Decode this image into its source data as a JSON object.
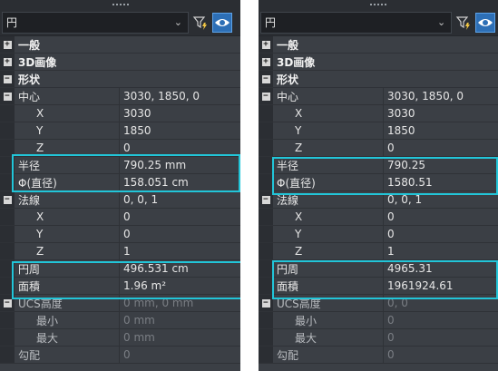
{
  "panels": [
    {
      "selector_value": "円",
      "rows": [
        {
          "kind": "cat",
          "expander": "+",
          "name": "一般",
          "value": ""
        },
        {
          "kind": "cat",
          "expander": "+",
          "name": "3D画像",
          "value": ""
        },
        {
          "kind": "cat",
          "expander": "−",
          "name": "形状",
          "value": ""
        },
        {
          "kind": "prop",
          "expander": "−",
          "indent": 1,
          "name": "中心",
          "value": "3030, 1850, 0"
        },
        {
          "kind": "prop",
          "indent": 2,
          "name": "X",
          "value": "3030"
        },
        {
          "kind": "prop",
          "indent": 2,
          "name": "Y",
          "value": "1850"
        },
        {
          "kind": "prop",
          "indent": 2,
          "name": "Z",
          "value": "0"
        },
        {
          "kind": "prop",
          "indent": 1,
          "name": "半径",
          "value": "790.25 mm"
        },
        {
          "kind": "prop",
          "indent": 1,
          "name": "Φ(直径)",
          "value": "158.051 cm"
        },
        {
          "kind": "prop",
          "expander": "−",
          "indent": 1,
          "name": "法線",
          "value": "0, 0, 1"
        },
        {
          "kind": "prop",
          "indent": 2,
          "name": "X",
          "value": "0"
        },
        {
          "kind": "prop",
          "indent": 2,
          "name": "Y",
          "value": "0"
        },
        {
          "kind": "prop",
          "indent": 2,
          "name": "Z",
          "value": "1"
        },
        {
          "kind": "prop",
          "indent": 1,
          "name": "円周",
          "value": "496.531 cm"
        },
        {
          "kind": "prop",
          "indent": 1,
          "name": "面積",
          "value": "1.96 m²"
        },
        {
          "kind": "prop",
          "expander": "−",
          "indent": 1,
          "name": "UCS高度",
          "value": "0 mm, 0 mm",
          "disabled": true
        },
        {
          "kind": "prop",
          "indent": 2,
          "name": "最小",
          "value": "0 mm",
          "disabled": true
        },
        {
          "kind": "prop",
          "indent": 2,
          "name": "最大",
          "value": "0 mm",
          "disabled": true
        },
        {
          "kind": "prop",
          "indent": 1,
          "name": "勾配",
          "value": "0",
          "disabled": true
        }
      ]
    },
    {
      "selector_value": "円",
      "rows": [
        {
          "kind": "cat",
          "expander": "+",
          "name": "一般",
          "value": ""
        },
        {
          "kind": "cat",
          "expander": "+",
          "name": "3D画像",
          "value": ""
        },
        {
          "kind": "cat",
          "expander": "−",
          "name": "形状",
          "value": ""
        },
        {
          "kind": "prop",
          "expander": "−",
          "indent": 1,
          "name": "中心",
          "value": "3030, 1850, 0"
        },
        {
          "kind": "prop",
          "indent": 2,
          "name": "X",
          "value": "3030"
        },
        {
          "kind": "prop",
          "indent": 2,
          "name": "Y",
          "value": "1850"
        },
        {
          "kind": "prop",
          "indent": 2,
          "name": "Z",
          "value": "0"
        },
        {
          "kind": "prop",
          "indent": 1,
          "name": "半径",
          "value": "790.25"
        },
        {
          "kind": "prop",
          "indent": 1,
          "name": "Φ(直径)",
          "value": "1580.51"
        },
        {
          "kind": "prop",
          "expander": "−",
          "indent": 1,
          "name": "法線",
          "value": "0, 0, 1"
        },
        {
          "kind": "prop",
          "indent": 2,
          "name": "X",
          "value": "0"
        },
        {
          "kind": "prop",
          "indent": 2,
          "name": "Y",
          "value": "0"
        },
        {
          "kind": "prop",
          "indent": 2,
          "name": "Z",
          "value": "1"
        },
        {
          "kind": "prop",
          "indent": 1,
          "name": "円周",
          "value": "4965.31"
        },
        {
          "kind": "prop",
          "indent": 1,
          "name": "面積",
          "value": "1961924.61"
        },
        {
          "kind": "prop",
          "expander": "−",
          "indent": 1,
          "name": "UCS高度",
          "value": "0, 0",
          "disabled": true
        },
        {
          "kind": "prop",
          "indent": 2,
          "name": "最小",
          "value": "0",
          "disabled": true
        },
        {
          "kind": "prop",
          "indent": 2,
          "name": "最大",
          "value": "0",
          "disabled": true
        },
        {
          "kind": "prop",
          "indent": 1,
          "name": "勾配",
          "value": "0",
          "disabled": true
        }
      ]
    }
  ],
  "icons": {
    "filter": "filter-lightning-icon",
    "eye": "eye-icon",
    "chevron": "chevron-down-icon"
  },
  "colors": {
    "panel_bg": "#3b3f45",
    "toolbar_bg": "#2b2e33",
    "highlight": "#22c5d8",
    "eye_button": "#2d6fb6"
  }
}
